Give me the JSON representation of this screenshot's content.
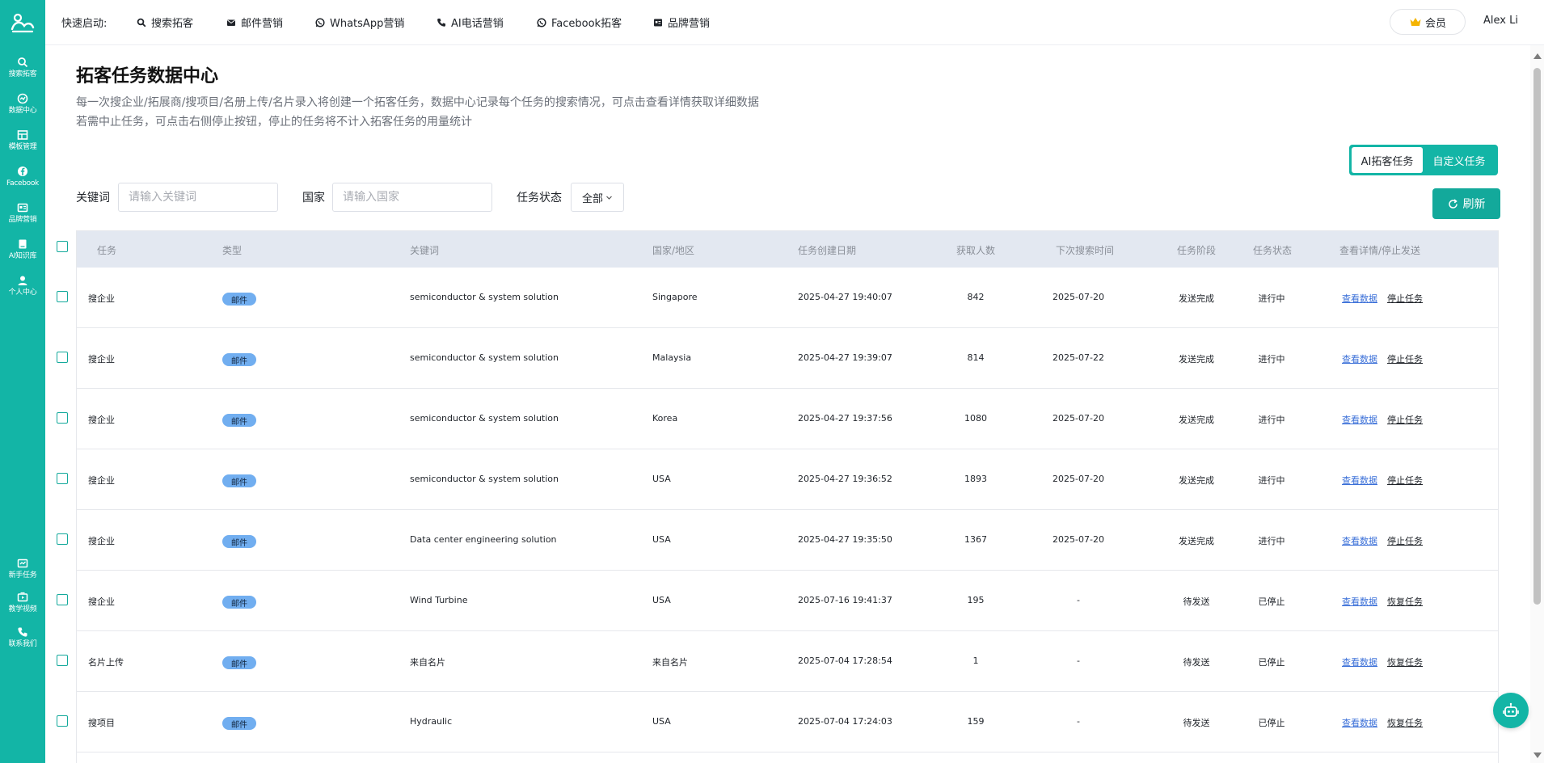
{
  "sidebar": {
    "items": [
      {
        "label": "搜索拓客",
        "icon": "search-icon"
      },
      {
        "label": "数据中心",
        "icon": "data-icon"
      },
      {
        "label": "模板管理",
        "icon": "template-icon"
      },
      {
        "label": "Facebook",
        "icon": "facebook-icon"
      },
      {
        "label": "品牌营销",
        "icon": "brand-icon"
      },
      {
        "label": "AI知识库",
        "icon": "book-icon"
      },
      {
        "label": "个人中心",
        "icon": "user-icon"
      }
    ],
    "bottom_items": [
      {
        "label": "新手任务",
        "icon": "task-icon"
      },
      {
        "label": "教学视频",
        "icon": "video-icon"
      },
      {
        "label": "联系我们",
        "icon": "phone-icon"
      }
    ]
  },
  "topbar": {
    "quick_label": "快速启动:",
    "links": [
      {
        "label": "搜索拓客",
        "icon": "search-icon"
      },
      {
        "label": "邮件营销",
        "icon": "mail-icon"
      },
      {
        "label": "WhatsApp营销",
        "icon": "whatsapp-icon"
      },
      {
        "label": "AI电话营销",
        "icon": "phone-icon"
      },
      {
        "label": "Facebook拓客",
        "icon": "facebook-icon"
      },
      {
        "label": "品牌营销",
        "icon": "brand-icon"
      }
    ],
    "member_label": "会员",
    "username": "Alex Li"
  },
  "page": {
    "title": "拓客任务数据中心",
    "desc_line1": "每一次搜企业/拓展商/搜项目/名册上传/名片录入将创建一个拓客任务，数据中心记录每个任务的搜索情况，可点击查看详情获取详细数据",
    "desc_line2": "若需中止任务，可点击右侧停止按钮，停止的任务将不计入拓客任务的用量统计"
  },
  "toggle": {
    "ai_label": "AI拓客任务",
    "custom_label": "自定义任务"
  },
  "filters": {
    "keyword_label": "关键词",
    "keyword_placeholder": "请输入关键词",
    "country_label": "国家",
    "country_placeholder": "请输入国家",
    "status_label": "任务状态",
    "status_value": "全部"
  },
  "refresh_label": "刷新",
  "table": {
    "headers": [
      "任务",
      "类型",
      "关键词",
      "国家/地区",
      "任务创建日期",
      "获取人数",
      "下次搜索时间",
      "任务阶段",
      "任务状态",
      "查看详情/停止发送"
    ],
    "view_label": "查看数据",
    "rows": [
      {
        "task": "搜企业",
        "type": "邮件",
        "keyword": "semiconductor & system solution",
        "country": "Singapore",
        "created": "2025-04-27 19:40:07",
        "count": "842",
        "next": "2025-07-20",
        "stage": "发送完成",
        "status": "进行中",
        "action": "停止任务"
      },
      {
        "task": "搜企业",
        "type": "邮件",
        "keyword": "semiconductor & system solution",
        "country": "Malaysia",
        "created": "2025-04-27 19:39:07",
        "count": "814",
        "next": "2025-07-22",
        "stage": "发送完成",
        "status": "进行中",
        "action": "停止任务"
      },
      {
        "task": "搜企业",
        "type": "邮件",
        "keyword": "semiconductor & system solution",
        "country": "Korea",
        "created": "2025-04-27 19:37:56",
        "count": "1080",
        "next": "2025-07-20",
        "stage": "发送完成",
        "status": "进行中",
        "action": "停止任务"
      },
      {
        "task": "搜企业",
        "type": "邮件",
        "keyword": "semiconductor & system solution",
        "country": "USA",
        "created": "2025-04-27 19:36:52",
        "count": "1893",
        "next": "2025-07-20",
        "stage": "发送完成",
        "status": "进行中",
        "action": "停止任务"
      },
      {
        "task": "搜企业",
        "type": "邮件",
        "keyword": "Data center engineering solution",
        "country": "USA",
        "created": "2025-04-27 19:35:50",
        "count": "1367",
        "next": "2025-07-20",
        "stage": "发送完成",
        "status": "进行中",
        "action": "停止任务"
      },
      {
        "task": "搜企业",
        "type": "邮件",
        "keyword": "Wind Turbine",
        "country": "USA",
        "created": "2025-07-16 19:41:37",
        "count": "195",
        "next": "-",
        "stage": "待发送",
        "status": "已停止",
        "action": "恢复任务"
      },
      {
        "task": "名片上传",
        "type": "邮件",
        "keyword": "来自名片",
        "country": "来自名片",
        "created": "2025-07-04 17:28:54",
        "count": "1",
        "next": "-",
        "stage": "待发送",
        "status": "已停止",
        "action": "恢复任务"
      },
      {
        "task": "搜项目",
        "type": "邮件",
        "keyword": "Hydraulic",
        "country": "USA",
        "created": "2025-07-04 17:24:03",
        "count": "159",
        "next": "-",
        "stage": "待发送",
        "status": "已停止",
        "action": "恢复任务"
      }
    ]
  },
  "colors": {
    "brand": "#13b5a6",
    "accent": "#13a99b",
    "header_bg": "#e3e8f1",
    "link": "#3a6fd8",
    "badge": "#71aef0"
  }
}
